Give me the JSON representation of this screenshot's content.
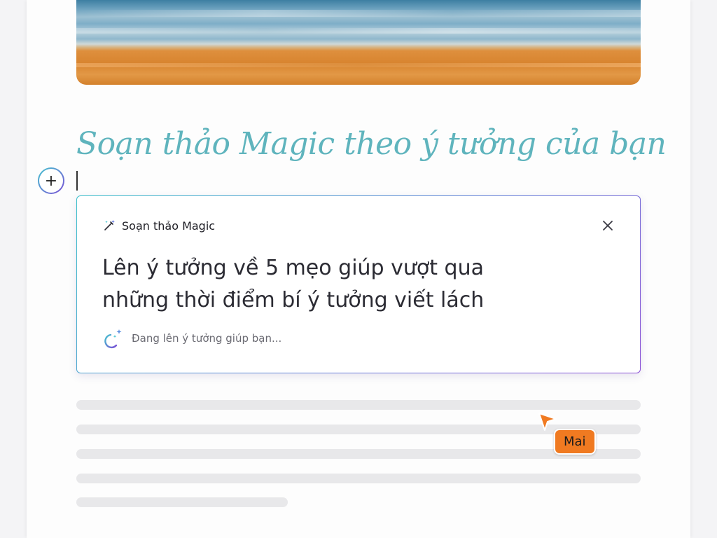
{
  "document": {
    "heading": "Soạn thảo Magic theo ý tưởng của bạn"
  },
  "editor": {
    "add_block_symbol": "+"
  },
  "magic_panel": {
    "title": "Soạn thảo Magic",
    "prompt": "Lên ý tưởng về 5 mẹo giúp vượt qua những thời điểm bí ý tưởng viết lách",
    "status": "Đang lên ý tưởng giúp bạn...",
    "icons": {
      "title_icon": "magic-wand-icon",
      "close_icon": "close-icon",
      "status_icon": "sparkle-spinner-icon"
    }
  },
  "collaborator": {
    "name": "Mai",
    "color": "#f07a21"
  },
  "colors": {
    "heading": "#5fb4bd",
    "panel_gradient_start": "#3fc1cc",
    "panel_gradient_end": "#8b4fd7"
  }
}
